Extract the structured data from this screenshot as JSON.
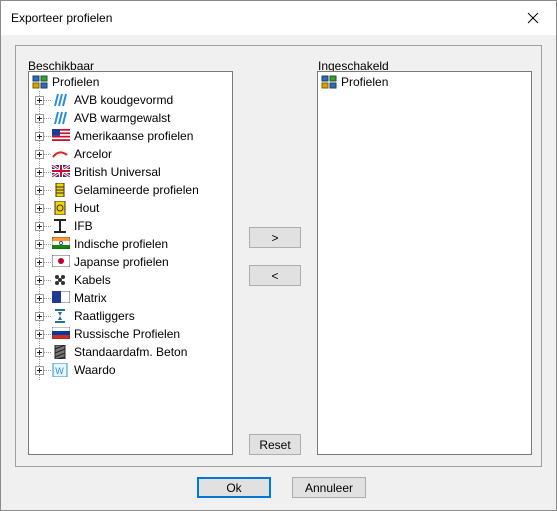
{
  "window": {
    "title": "Exporteer profielen"
  },
  "left": {
    "label": "Beschikbaar",
    "root": "Profielen",
    "items": [
      {
        "label": "AVB koudgevormd",
        "icon": "avb-koud-icon"
      },
      {
        "label": "AVB warmgewalst",
        "icon": "avb-warm-icon"
      },
      {
        "label": "Amerikaanse profielen",
        "icon": "us-flag-icon"
      },
      {
        "label": "Arcelor",
        "icon": "arcelor-icon"
      },
      {
        "label": "British Universal",
        "icon": "uk-flag-icon"
      },
      {
        "label": "Gelamineerde profielen",
        "icon": "glulam-icon"
      },
      {
        "label": "Hout",
        "icon": "wood-icon"
      },
      {
        "label": "IFB",
        "icon": "ifb-icon"
      },
      {
        "label": "Indische profielen",
        "icon": "india-flag-icon"
      },
      {
        "label": "Japanse profielen",
        "icon": "japan-flag-icon"
      },
      {
        "label": "Kabels",
        "icon": "cable-icon"
      },
      {
        "label": "Matrix",
        "icon": "matrix-icon"
      },
      {
        "label": "Raatliggers",
        "icon": "castellated-beam-icon"
      },
      {
        "label": "Russische Profielen",
        "icon": "russia-flag-icon"
      },
      {
        "label": "Standaardafm. Beton",
        "icon": "concrete-icon"
      },
      {
        "label": "Waardo",
        "icon": "waardo-icon"
      }
    ]
  },
  "right": {
    "label": "Ingeschakeld",
    "root": "Profielen"
  },
  "buttons": {
    "add": ">",
    "remove": "<",
    "reset": "Reset",
    "ok": "Ok",
    "cancel": "Annuleer"
  },
  "colors": {
    "accent": "#0078d7",
    "dialog_bg": "#f0f0f0"
  }
}
